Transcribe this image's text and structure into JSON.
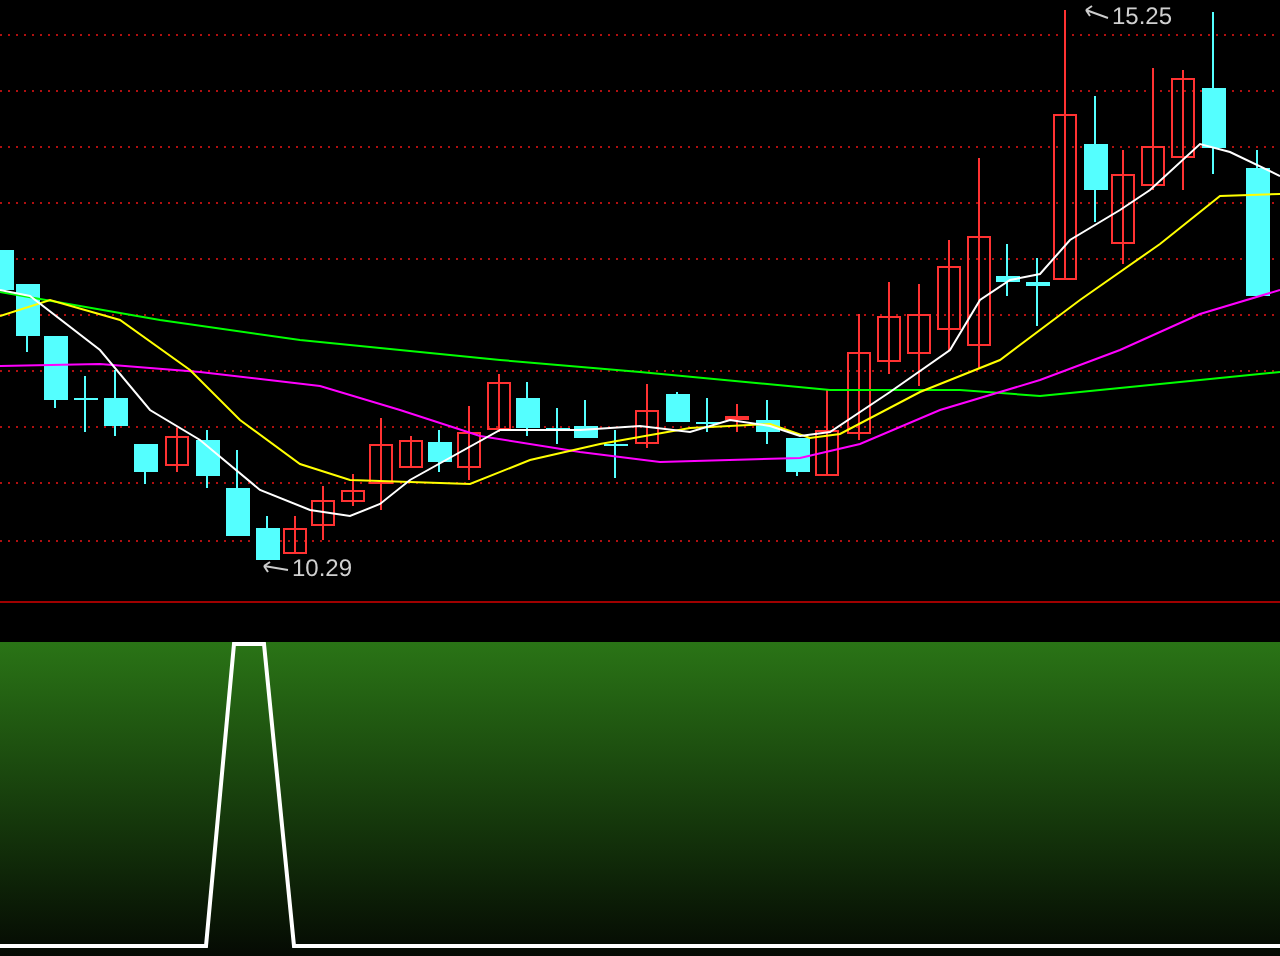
{
  "price_chart": {
    "high_label": "15.25",
    "low_label": "10.29"
  }
}
